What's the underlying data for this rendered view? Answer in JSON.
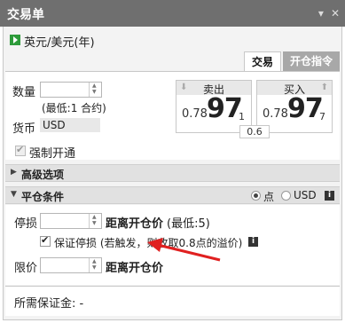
{
  "window": {
    "title": "交易单"
  },
  "pair": {
    "label": "英元/美元",
    "suffix": "(年)"
  },
  "tabs": [
    {
      "label": "交易"
    },
    {
      "label": "开仓指令"
    }
  ],
  "quantity": {
    "label": "数量",
    "value": "",
    "hint": "(最低:1 合约)"
  },
  "currency": {
    "label": "货币",
    "value": "USD"
  },
  "sell": {
    "label": "卖出",
    "prefix": "0.78",
    "big": "97",
    "sub": "1"
  },
  "buy": {
    "label": "买入",
    "prefix": "0.78",
    "big": "97",
    "sub": "7"
  },
  "spread": "0.6",
  "force_open": {
    "label": "强制开通",
    "checked": true
  },
  "advanced": {
    "label": "高级选项"
  },
  "close_conditions": {
    "label": "平仓条件",
    "unit_options": [
      {
        "label": "点",
        "selected": true
      },
      {
        "label": "USD",
        "selected": false
      }
    ]
  },
  "stop_loss": {
    "label": "停损",
    "value": "",
    "distance_label": "距离开仓价",
    "min_label": "(最低:5)"
  },
  "guaranteed_stop": {
    "label": "保证停损 (若触发，则收取0.8点的溢价)",
    "checked": true
  },
  "limit": {
    "label": "限价",
    "value": "",
    "distance_label": "距离开仓价"
  },
  "margin": {
    "label": "所需保证金: -"
  },
  "colors": {
    "titlebar": "#6f6f6f",
    "green": "#2d9b3a",
    "annotation_red": "#e02020"
  }
}
